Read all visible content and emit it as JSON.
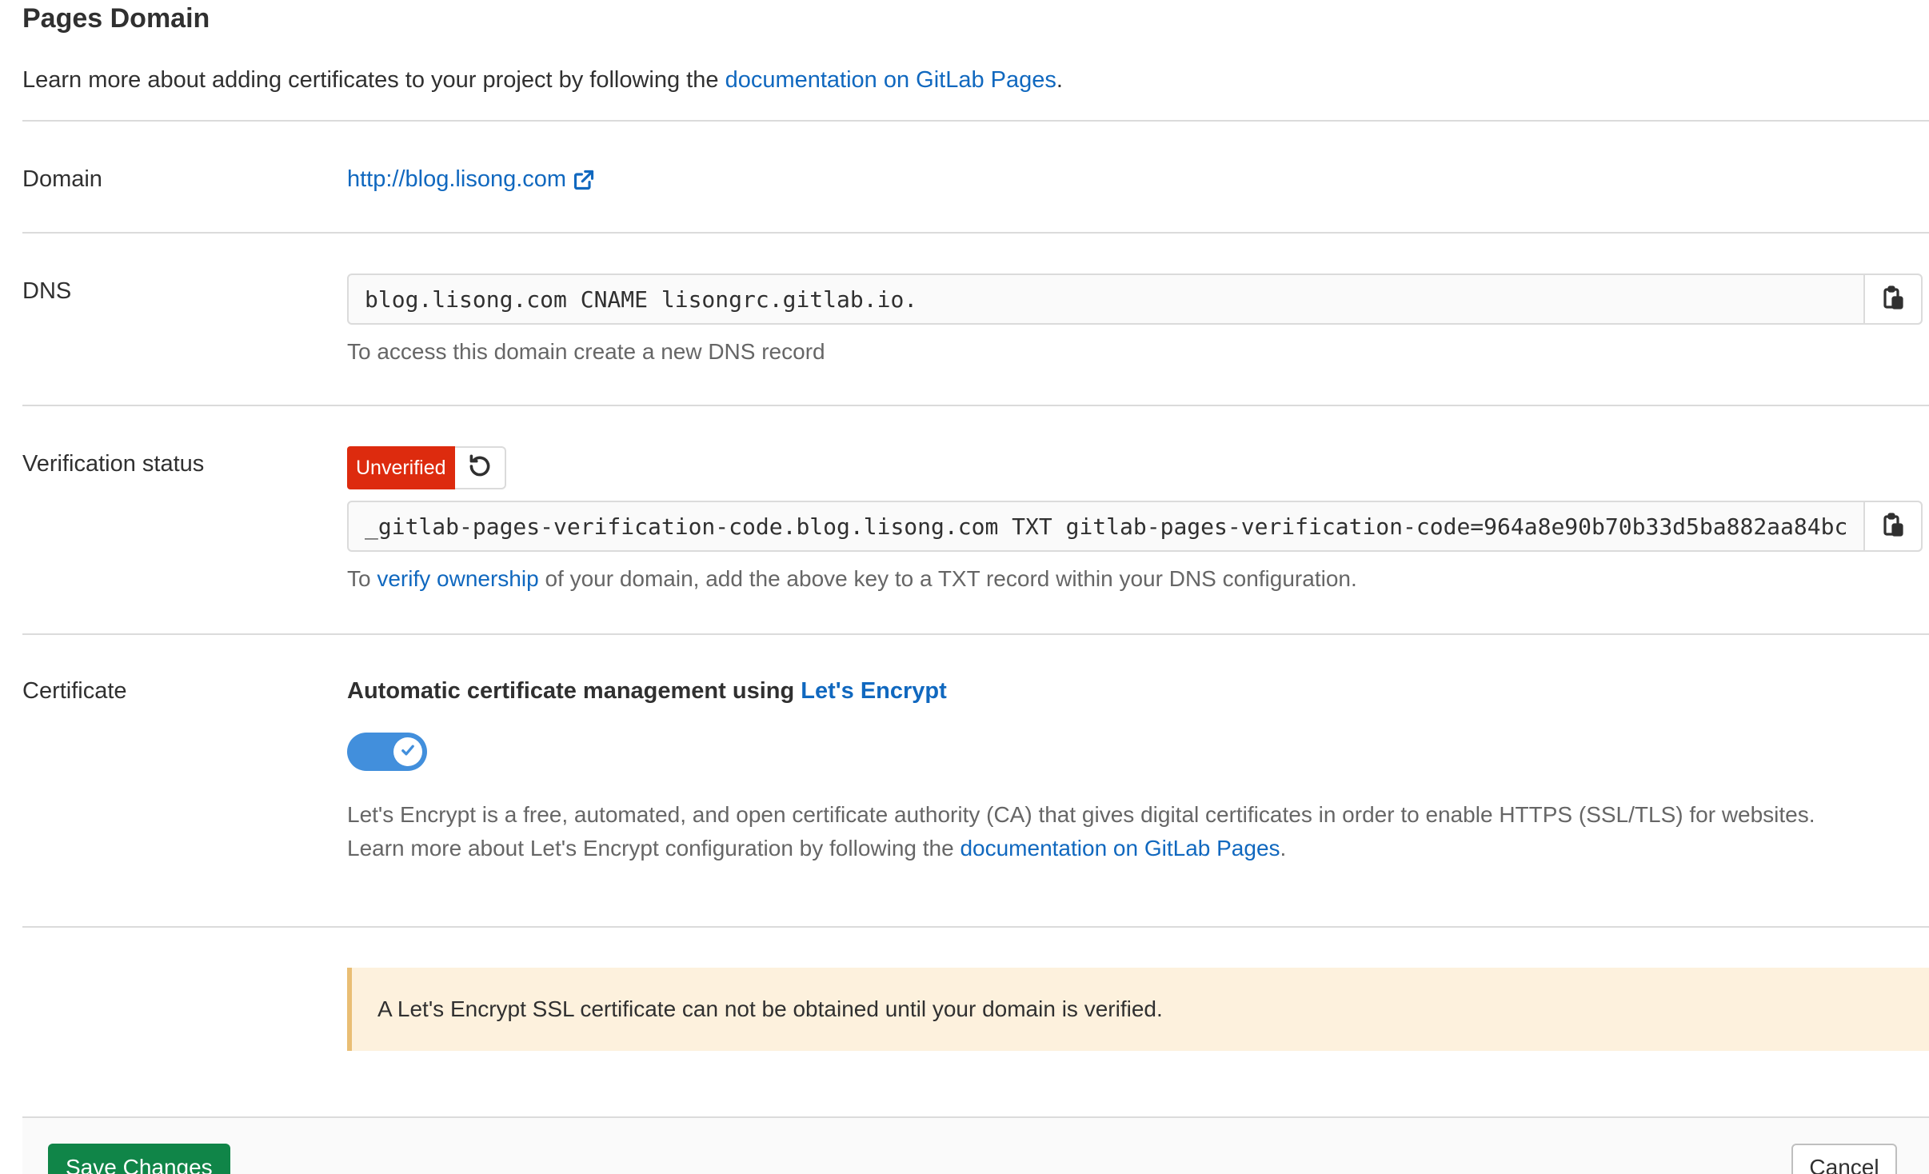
{
  "page": {
    "title": "Pages Domain",
    "intro_text": "Learn more about adding certificates to your project by following the ",
    "intro_link": "documentation on GitLab Pages",
    "intro_suffix": "."
  },
  "domain": {
    "label": "Domain",
    "url": "http://blog.lisong.com"
  },
  "dns": {
    "label": "DNS",
    "record": "blog.lisong.com CNAME lisongrc.gitlab.io.",
    "help": "To access this domain create a new DNS record"
  },
  "verification": {
    "label": "Verification status",
    "badge": "Unverified",
    "badge_color": "#dd2b0e",
    "record": "_gitlab-pages-verification-code.blog.lisong.com TXT gitlab-pages-verification-code=964a8e90b70b33d5ba882aa84bc",
    "help_prefix": "To ",
    "help_link": "verify ownership",
    "help_suffix": " of your domain, add the above key to a TXT record within your DNS configuration."
  },
  "certificate": {
    "label": "Certificate",
    "title_prefix": "Automatic certificate management using ",
    "title_link": "Let's Encrypt",
    "toggle_on": true,
    "toggle_color": "#428fdc",
    "desc_line1": "Let's Encrypt is a free, automated, and open certificate authority (CA) that gives digital certificates in order to enable HTTPS (SSL/TLS) for websites.",
    "desc_line2_prefix": "Learn more about Let's Encrypt configuration by following the ",
    "desc_line2_link": "documentation on GitLab Pages",
    "desc_line2_suffix": "."
  },
  "alert": {
    "text": "A Let's Encrypt SSL certificate can not be obtained until your domain is verified.",
    "bg_color": "#fdf1dd"
  },
  "footer": {
    "save_label": "Save Changes",
    "save_color": "#108548",
    "cancel_label": "Cancel"
  },
  "icons": {
    "external": "external-link-icon",
    "copy": "clipboard-icon",
    "retry": "retry-icon",
    "check": "check-icon"
  }
}
